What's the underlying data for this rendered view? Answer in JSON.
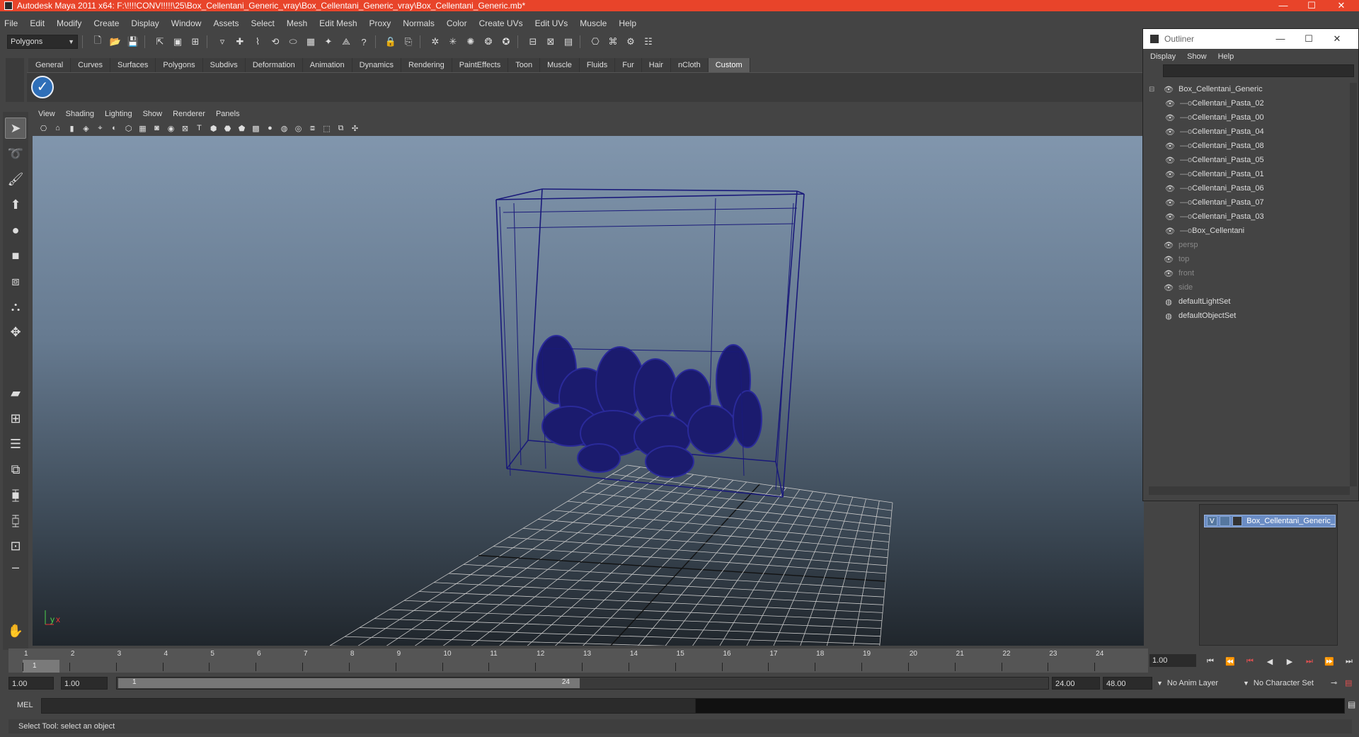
{
  "window": {
    "title": "Autodesk Maya 2011 x64: F:\\!!!!CONV!!!!!\\25\\Box_Cellentani_Generic_vray\\Box_Cellentani_Generic_vray\\Box_Cellentani_Generic.mb*",
    "minimize": "—",
    "maximize": "☐",
    "close": "✕"
  },
  "menubar": [
    "File",
    "Edit",
    "Modify",
    "Create",
    "Display",
    "Window",
    "Assets",
    "Select",
    "Mesh",
    "Edit Mesh",
    "Proxy",
    "Normals",
    "Color",
    "Create UVs",
    "Edit UVs",
    "Muscle",
    "Help"
  ],
  "statusline": {
    "mode": "Polygons"
  },
  "shelf": {
    "tabs": [
      "General",
      "Curves",
      "Surfaces",
      "Polygons",
      "Subdivs",
      "Deformation",
      "Animation",
      "Dynamics",
      "Rendering",
      "PaintEffects",
      "Toon",
      "Muscle",
      "Fluids",
      "Fur",
      "Hair",
      "nCloth",
      "Custom"
    ],
    "active_tab": "Custom"
  },
  "viewport": {
    "menu": [
      "View",
      "Shading",
      "Lighting",
      "Show",
      "Renderer",
      "Panels"
    ],
    "axis_y": "y",
    "axis_x": "x",
    "wire_color": "#1a1a7a",
    "grid_color": "#c8c8c8"
  },
  "outliner": {
    "title": "Outliner",
    "menu": [
      "Display",
      "Show",
      "Help"
    ],
    "items": [
      {
        "label": "Box_Cellentani_Generic",
        "level": 0
      },
      {
        "label": "Cellentani_Pasta_02",
        "level": 1
      },
      {
        "label": "Cellentani_Pasta_00",
        "level": 1
      },
      {
        "label": "Cellentani_Pasta_04",
        "level": 1
      },
      {
        "label": "Cellentani_Pasta_08",
        "level": 1
      },
      {
        "label": "Cellentani_Pasta_05",
        "level": 1
      },
      {
        "label": "Cellentani_Pasta_01",
        "level": 1
      },
      {
        "label": "Cellentani_Pasta_06",
        "level": 1
      },
      {
        "label": "Cellentani_Pasta_07",
        "level": 1
      },
      {
        "label": "Cellentani_Pasta_03",
        "level": 1
      },
      {
        "label": "Box_Cellentani",
        "level": 1
      },
      {
        "label": "persp",
        "level": 0,
        "dim": true
      },
      {
        "label": "top",
        "level": 0,
        "dim": true
      },
      {
        "label": "front",
        "level": 0,
        "dim": true
      },
      {
        "label": "side",
        "level": 0,
        "dim": true
      },
      {
        "label": "defaultLightSet",
        "level": 0
      },
      {
        "label": "defaultObjectSet",
        "level": 0
      }
    ]
  },
  "layers": {
    "visible_flag": "V",
    "layer_name": "Box_Cellentani_Generic_"
  },
  "timeline": {
    "ticks": [
      "1",
      "2",
      "3",
      "4",
      "5",
      "6",
      "7",
      "8",
      "9",
      "10",
      "11",
      "12",
      "13",
      "14",
      "15",
      "16",
      "17",
      "18",
      "19",
      "20",
      "21",
      "22",
      "23",
      "24"
    ],
    "current_frame": "1",
    "frame_field": "1.00"
  },
  "range": {
    "start": "1.00",
    "playback_start": "1.00",
    "handle_start": "1",
    "handle_end": "24",
    "playback_end": "24.00",
    "end": "48.00",
    "anim_layer": "No Anim Layer",
    "character_set": "No Character Set"
  },
  "cmdline": {
    "label": "MEL"
  },
  "helpline": {
    "text": "Select Tool: select an object"
  }
}
